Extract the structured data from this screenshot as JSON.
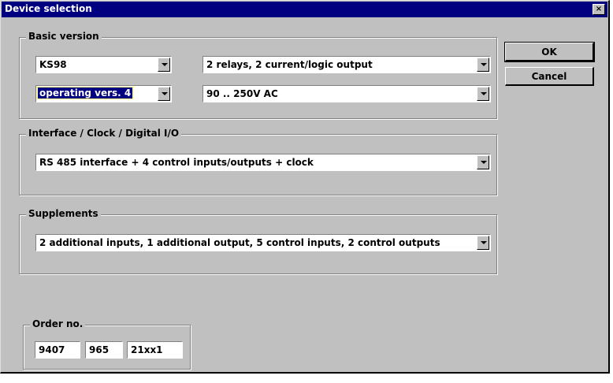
{
  "window": {
    "title": "Device selection",
    "close_glyph": "×"
  },
  "basic_version": {
    "label": "Basic version",
    "model": "KS98",
    "outputs": "2 relays, 2 current/logic output",
    "operating_version": "operating vers. 4",
    "power": "90 .. 250V AC"
  },
  "interface": {
    "label": "Interface / Clock / Digital I/O",
    "value": "RS 485 interface + 4 control inputs/outputs + clock"
  },
  "supplements": {
    "label": "Supplements",
    "value": "2 additional inputs, 1 additional output, 5 control inputs, 2 control outputs"
  },
  "order": {
    "label": "Order no.",
    "part1": "9407",
    "part2": "965",
    "part3": "21xx1"
  },
  "buttons": {
    "ok": "OK",
    "cancel": "Cancel"
  },
  "icons": {
    "dropdown": "chevron-down-icon",
    "close": "close-icon"
  }
}
